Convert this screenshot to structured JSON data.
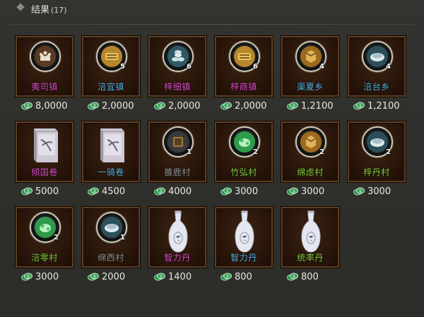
{
  "header": {
    "title": "结果",
    "count": "(17)"
  },
  "items": [
    {
      "name": "夷司镇",
      "color": "#d94cc8",
      "icon": "town-emblem-icon",
      "count": "",
      "price": "8,0000"
    },
    {
      "name": "涪宜镇",
      "color": "#4fb3e6",
      "icon": "gold-ingot-icon",
      "count": "5",
      "price": "2,0000"
    },
    {
      "name": "梓细镇",
      "color": "#d94cc8",
      "icon": "silver-coins-icon",
      "count": "6",
      "price": "2,0000"
    },
    {
      "name": "梓商镇",
      "color": "#d94cc8",
      "icon": "gold-ingot-icon",
      "count": "6",
      "price": "2,0000"
    },
    {
      "name": "渠夏乡",
      "color": "#4fb3e6",
      "icon": "gold-box-icon",
      "count": "4",
      "price": "1,2100"
    },
    {
      "name": "涪台乡",
      "color": "#4fb3e6",
      "icon": "silver-ingot-icon",
      "count": "4",
      "price": "1,2100"
    },
    {
      "name": "傾国卷",
      "color": "#d94cc8",
      "icon": "scroll-book-icon",
      "count": "",
      "price": "5000"
    },
    {
      "name": "一骑卷",
      "color": "#4fb3e6",
      "icon": "scroll-book-icon",
      "count": "",
      "price": "4500"
    },
    {
      "name": "雒鹿村",
      "color": "#8f8f8f",
      "icon": "copper-box-icon",
      "count": "1",
      "price": "4000"
    },
    {
      "name": "竹弘村",
      "color": "#7fcf3e",
      "icon": "jade-icon",
      "count": "2",
      "price": "3000"
    },
    {
      "name": "绵虑村",
      "color": "#7fcf3e",
      "icon": "gold-box-icon",
      "count": "2",
      "price": "3000"
    },
    {
      "name": "梓丹村",
      "color": "#7fcf3e",
      "icon": "silver-ingot-icon",
      "count": "2",
      "price": "3000"
    },
    {
      "name": "涪零村",
      "color": "#7fcf3e",
      "icon": "jade-icon",
      "count": "2",
      "price": "3000"
    },
    {
      "name": "绵西村",
      "color": "#8f8f8f",
      "icon": "silver-ingot-icon",
      "count": "1",
      "price": "2000"
    },
    {
      "name": "智力丹",
      "color": "#d94cc8",
      "icon": "porcelain-vase-icon",
      "count": "",
      "price": "1400"
    },
    {
      "name": "智力丹",
      "color": "#4fb3e6",
      "icon": "porcelain-vase-icon",
      "count": "",
      "price": "800"
    },
    {
      "name": "统率丹",
      "color": "#7fcf3e",
      "icon": "porcelain-vase-icon",
      "count": "",
      "price": "800"
    }
  ]
}
